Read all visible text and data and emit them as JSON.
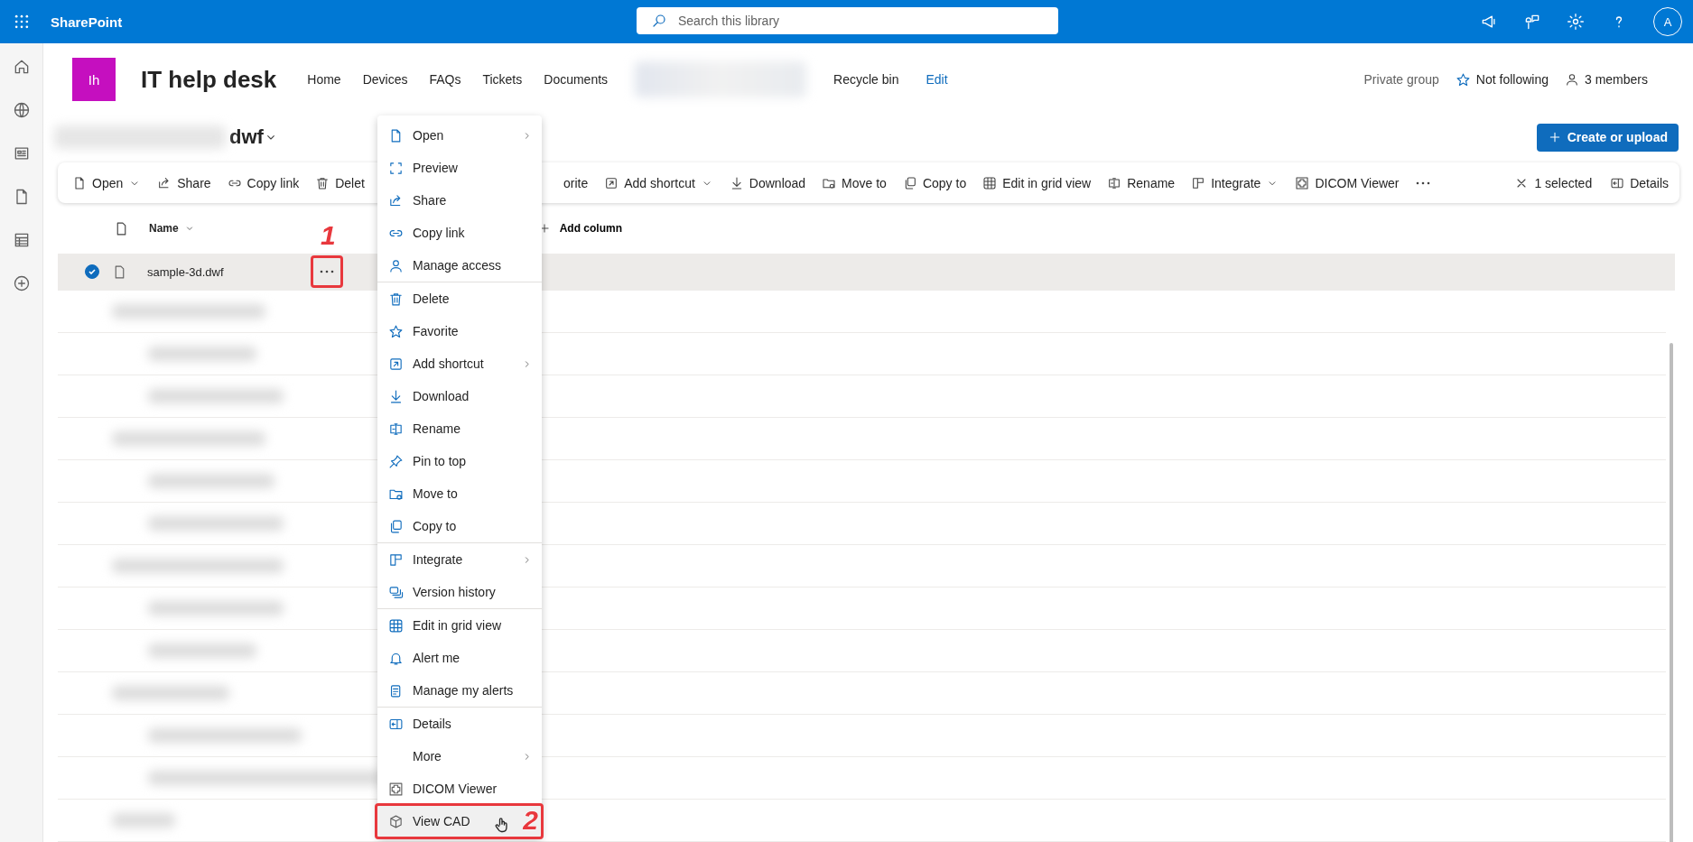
{
  "top_bar": {
    "app_name": "SharePoint",
    "search": {
      "placeholder": "Search this library"
    },
    "avatar": "A"
  },
  "site": {
    "logo": "Ih",
    "title": "IT help desk",
    "nav": [
      {
        "kind": "page",
        "label": "Home"
      },
      {
        "kind": "page",
        "label": "Devices"
      },
      {
        "kind": "page",
        "label": "FAQs"
      },
      {
        "kind": "page",
        "label": "Tickets"
      },
      {
        "kind": "page",
        "label": "Documents"
      },
      {
        "kind": "redacted"
      },
      {
        "kind": "page",
        "label": "Recycle bin"
      },
      {
        "kind": "edit",
        "label": "Edit"
      }
    ],
    "privacy": "Private group",
    "follow": "Not following",
    "members": "3 members"
  },
  "library": {
    "title": "dwf",
    "create_button": "Create or upload"
  },
  "toolbar": {
    "items_before_menu": [
      {
        "label": "Open",
        "kind": "document",
        "dropdown": true
      },
      {
        "label": "Share",
        "kind": "share",
        "dropdown": false
      },
      {
        "label": "Copy link",
        "kind": "link",
        "dropdown": false
      },
      {
        "label": "Delet",
        "kind": "trash",
        "dropdown": false
      }
    ],
    "items_after_menu": [
      {
        "label": "orite",
        "kind": "none",
        "dropdown": false
      },
      {
        "label": "Add shortcut",
        "kind": "arrow-box",
        "dropdown": true
      },
      {
        "label": "Download",
        "kind": "download",
        "dropdown": false
      },
      {
        "label": "Move to",
        "kind": "folder",
        "dropdown": false
      },
      {
        "label": "Copy to",
        "kind": "copy",
        "dropdown": false
      },
      {
        "label": "Edit in grid view",
        "kind": "grid",
        "dropdown": false
      },
      {
        "label": "Rename",
        "kind": "rename",
        "dropdown": false
      },
      {
        "label": "Integrate",
        "kind": "layout",
        "dropdown": true
      },
      {
        "label": "DICOM Viewer",
        "kind": "cross",
        "dropdown": false
      }
    ],
    "selection": "1 selected",
    "details": "Details"
  },
  "table": {
    "columns": [
      {
        "label": "Name"
      }
    ],
    "add_column": "Add column",
    "rows": [
      {
        "name": "sample-3d.dwf",
        "selected": true,
        "annotation": "1"
      }
    ]
  },
  "menu": {
    "sections": [
      [
        {
          "label": "Open",
          "kind": "document",
          "submenu": true,
          "hovered": false
        },
        {
          "label": "Preview",
          "kind": "frame",
          "submenu": false,
          "hovered": false
        },
        {
          "label": "Share",
          "kind": "share",
          "submenu": false,
          "hovered": false
        },
        {
          "label": "Copy link",
          "kind": "link",
          "submenu": false,
          "hovered": false
        },
        {
          "label": "Manage access",
          "kind": "person",
          "submenu": false,
          "hovered": false
        }
      ],
      [
        {
          "label": "Delete",
          "kind": "trash",
          "submenu": false,
          "hovered": false
        },
        {
          "label": "Favorite",
          "kind": "star",
          "submenu": false,
          "hovered": false
        },
        {
          "label": "Add shortcut",
          "kind": "arrow-box",
          "submenu": true,
          "hovered": false
        },
        {
          "label": "Download",
          "kind": "download",
          "submenu": false,
          "hovered": false
        },
        {
          "label": "Rename",
          "kind": "rename",
          "submenu": false,
          "hovered": false
        },
        {
          "label": "Pin to top",
          "kind": "pin",
          "submenu": false,
          "hovered": false
        },
        {
          "label": "Move to",
          "kind": "folder",
          "submenu": false,
          "hovered": false
        },
        {
          "label": "Copy to",
          "kind": "copy",
          "submenu": false,
          "hovered": false
        }
      ],
      [
        {
          "label": "Integrate",
          "kind": "layout",
          "submenu": true,
          "hovered": false
        },
        {
          "label": "Version history",
          "kind": "stack",
          "submenu": false,
          "hovered": false
        }
      ],
      [
        {
          "label": "Edit in grid view",
          "kind": "grid",
          "submenu": false,
          "hovered": false
        },
        {
          "label": "Alert me",
          "kind": "bell",
          "submenu": false,
          "hovered": false
        },
        {
          "label": "Manage my alerts",
          "kind": "notes",
          "submenu": false,
          "hovered": false
        }
      ],
      [
        {
          "label": "Details",
          "kind": "panel",
          "submenu": false,
          "hovered": false
        },
        {
          "label": "More",
          "kind": "none",
          "submenu": true,
          "hovered": false
        },
        {
          "label": "DICOM Viewer",
          "kind": "cross",
          "submenu": false,
          "hovered": false
        },
        {
          "label": "View CAD",
          "kind": "cube",
          "submenu": false,
          "hovered": true,
          "annotation": "2"
        }
      ]
    ]
  }
}
